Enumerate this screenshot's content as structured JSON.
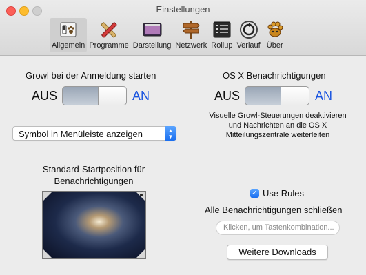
{
  "window": {
    "title": "Einstellungen"
  },
  "toolbar": {
    "items": [
      {
        "label": "Allgemein",
        "icon": "paw-switch-icon",
        "active": true
      },
      {
        "label": "Programme",
        "icon": "pencil-ruler-icon",
        "active": false
      },
      {
        "label": "Darstellung",
        "icon": "display-window-icon",
        "active": false
      },
      {
        "label": "Netzwerk",
        "icon": "signpost-icon",
        "active": false
      },
      {
        "label": "Rollup",
        "icon": "rollup-list-icon",
        "active": false
      },
      {
        "label": "Verlauf",
        "icon": "history-clock-icon",
        "active": false
      },
      {
        "label": "Über",
        "icon": "growl-paw-icon",
        "active": false
      }
    ]
  },
  "general": {
    "launch_label": "Growl bei der Anmeldung starten",
    "launch_off": "AUS",
    "launch_on": "AN",
    "launch_state": "AN",
    "menubar_select": "Symbol in Menüleiste anzeigen",
    "start_position_label": "Standard-Startposition für Benachrichtigungen",
    "osx_label": "OS X Benachrichtigungen",
    "osx_off": "AUS",
    "osx_on": "AN",
    "osx_state": "AN",
    "osx_note": "Visuelle Growl-Steuerungen deaktivieren und Nachrichten an die OS X Mitteilungszentrale weiterleiten",
    "use_rules_label": "Use Rules",
    "use_rules_checked": true,
    "close_all_label": "Alle Benachrichtigungen schließen",
    "shortcut_placeholder": "Klicken, um Tastenkombination...",
    "downloads_button": "Weitere Downloads"
  },
  "colors": {
    "accent": "#1a55e0",
    "checkbox": "#1a6ff0",
    "close": "#fc5f57",
    "minimize": "#fdbc2e"
  }
}
